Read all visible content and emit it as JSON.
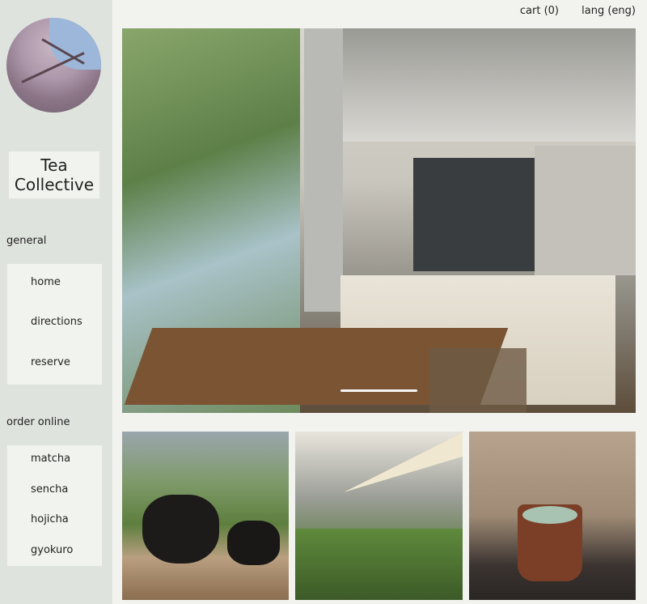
{
  "header": {
    "cart_label": "cart (0)",
    "lang_label": "lang (eng)"
  },
  "sidebar": {
    "brand": "Tea\nCollective",
    "general": {
      "heading": "general",
      "items": [
        {
          "label": "home"
        },
        {
          "label": "directions"
        },
        {
          "label": "reserve"
        }
      ]
    },
    "order": {
      "heading": "order online",
      "items": [
        {
          "label": "matcha"
        },
        {
          "label": "sencha"
        },
        {
          "label": "hojicha"
        },
        {
          "label": "gyokuro"
        }
      ]
    }
  },
  "colors": {
    "page_bg": "#f2f3ef",
    "sidebar_bg": "#dfe3de",
    "panel_bg": "#f1f3ee",
    "text": "#222222"
  }
}
